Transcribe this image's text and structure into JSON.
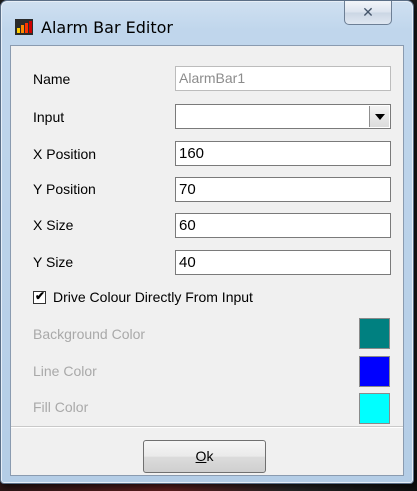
{
  "window": {
    "title": "Alarm Bar Editor",
    "close_glyph": "✕"
  },
  "fields": {
    "name": {
      "label": "Name",
      "value": "AlarmBar1"
    },
    "input": {
      "label": "Input",
      "value": ""
    },
    "x_position": {
      "label": "X Position",
      "value": "160"
    },
    "y_position": {
      "label": "Y Position",
      "value": "70"
    },
    "x_size": {
      "label": "X Size",
      "value": "60"
    },
    "y_size": {
      "label": "Y Size",
      "value": "40"
    }
  },
  "drive_colour": {
    "label": "Drive Colour Directly From Input",
    "checked": true,
    "check_glyph": "✔"
  },
  "colors": {
    "background": {
      "label": "Background Color",
      "hex": "#008080"
    },
    "line": {
      "label": "Line Color",
      "hex": "#0000ff"
    },
    "fill": {
      "label": "Fill Color",
      "hex": "#00ffff"
    }
  },
  "ok_button": {
    "mnemonic": "O",
    "rest": "k"
  },
  "icons": {
    "app": "bar-chart-icon",
    "close": "close-icon",
    "dropdown": "chevron-down-icon"
  }
}
